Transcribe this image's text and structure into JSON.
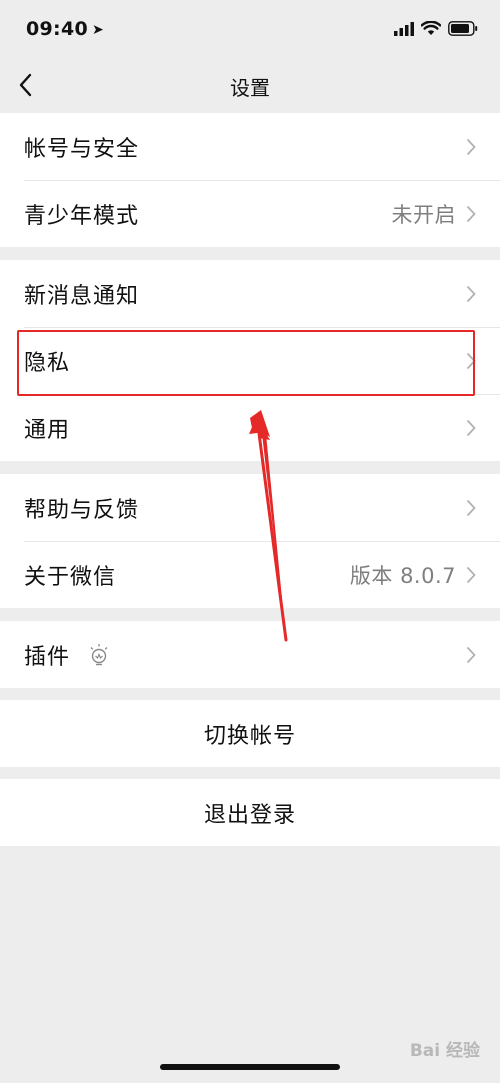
{
  "status_bar": {
    "time": "09:40"
  },
  "nav": {
    "title": "设置"
  },
  "groups": [
    {
      "items": [
        {
          "label": "帐号与安全",
          "value": ""
        },
        {
          "label": "青少年模式",
          "value": "未开启"
        }
      ]
    },
    {
      "items": [
        {
          "label": "新消息通知",
          "value": ""
        },
        {
          "label": "隐私",
          "value": ""
        },
        {
          "label": "通用",
          "value": ""
        }
      ]
    },
    {
      "items": [
        {
          "label": "帮助与反馈",
          "value": ""
        },
        {
          "label": "关于微信",
          "value": "版本 8.0.7"
        }
      ]
    },
    {
      "items": [
        {
          "label": "插件",
          "value": ""
        }
      ]
    }
  ],
  "actions": {
    "switch_account": "切换帐号",
    "logout": "退出登录"
  },
  "watermark": "Bai 经验",
  "colors": {
    "background": "#ededed",
    "highlight": "#e52828",
    "text": "#111111",
    "secondary_text": "#7f7f7f"
  }
}
